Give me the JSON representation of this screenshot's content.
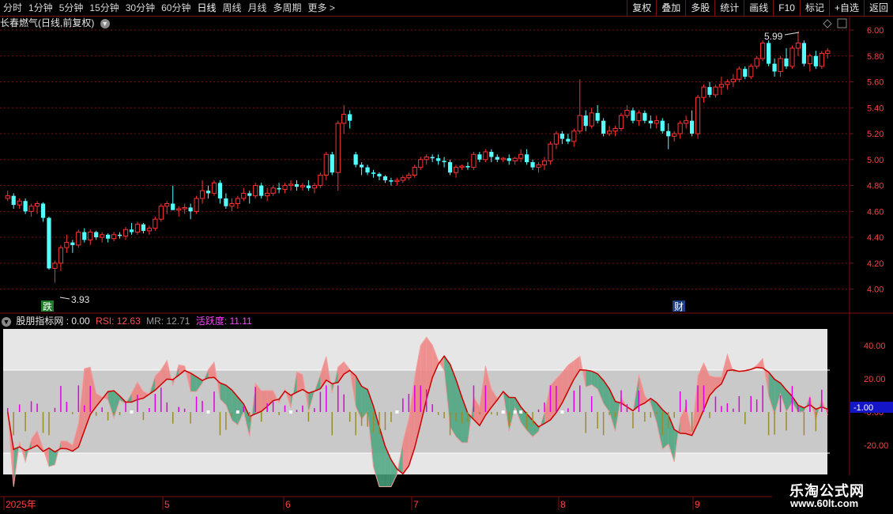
{
  "toolbar": {
    "periods": [
      "分时",
      "1分钟",
      "5分钟",
      "15分钟",
      "30分钟",
      "60分钟",
      "日线",
      "周线",
      "月线",
      "多周期",
      "更多 >"
    ],
    "active_period": "日线",
    "actions": [
      "复权",
      "叠加",
      "多股",
      "统计",
      "画线",
      "F10",
      "标记",
      "+自选",
      "返回"
    ]
  },
  "title": {
    "stock_name": "长春燃气(日线,前复权)",
    "chevron_icon": "chevron-down-icon"
  },
  "main_chart": {
    "y_ticks": [
      "6.00",
      "5.80",
      "5.60",
      "5.40",
      "5.20",
      "5.00",
      "4.80",
      "4.60",
      "4.40",
      "4.20",
      "4.00"
    ],
    "max_label": "5.99",
    "min_label": "3.93",
    "badge_down": "跌",
    "badge_finance": "财"
  },
  "indicator": {
    "name": "股朋指标网",
    "value_text": ": 0.00",
    "rsi_label": "RSI: 12.63",
    "mr_label": "MR: 12.71",
    "activity_label": "活跃度: 11.11",
    "y_ticks": [
      "40.00",
      "20.00",
      "-0.00",
      "-20.00"
    ],
    "current_value": "-1.00"
  },
  "x_axis": {
    "labels": [
      "2025年",
      "5",
      "6",
      "7",
      "8",
      "9"
    ]
  },
  "watermark": {
    "line1": "乐淘公式网",
    "line2": "www.60lt.com"
  },
  "colors": {
    "up": "#ff3232",
    "down": "#54ffff",
    "grid": "#7a1010",
    "rsi_fill_up": "#f08080",
    "rsi_fill_down": "#4aa57f",
    "activity_bar": "#e000e0",
    "neg_bar": "#9a8c2a",
    "mr_line": "#cc0000"
  },
  "chart_data": {
    "type": "candlestick",
    "ylim": [
      3.9,
      6.05
    ],
    "candles": [
      [
        4.7,
        4.76,
        4.68,
        4.72
      ],
      [
        4.72,
        4.74,
        4.62,
        4.65
      ],
      [
        4.65,
        4.7,
        4.62,
        4.68
      ],
      [
        4.68,
        4.7,
        4.58,
        4.6
      ],
      [
        4.6,
        4.66,
        4.56,
        4.64
      ],
      [
        4.64,
        4.68,
        4.58,
        4.66
      ],
      [
        4.66,
        4.67,
        4.52,
        4.55
      ],
      [
        4.55,
        4.56,
        4.15,
        4.16
      ],
      [
        4.16,
        4.22,
        4.05,
        4.2
      ],
      [
        4.2,
        4.34,
        4.14,
        4.32
      ],
      [
        4.32,
        4.42,
        4.28,
        4.36
      ],
      [
        4.36,
        4.38,
        4.28,
        4.34
      ],
      [
        4.34,
        4.46,
        4.32,
        4.44
      ],
      [
        4.44,
        4.47,
        4.36,
        4.38
      ],
      [
        4.38,
        4.46,
        4.34,
        4.44
      ],
      [
        4.44,
        4.45,
        4.38,
        4.4
      ],
      [
        4.4,
        4.44,
        4.36,
        4.42
      ],
      [
        4.42,
        4.43,
        4.36,
        4.39
      ],
      [
        4.39,
        4.44,
        4.37,
        4.42
      ],
      [
        4.42,
        4.44,
        4.39,
        4.41
      ],
      [
        4.41,
        4.48,
        4.38,
        4.46
      ],
      [
        4.46,
        4.51,
        4.42,
        4.44
      ],
      [
        4.44,
        4.52,
        4.42,
        4.5
      ],
      [
        4.5,
        4.51,
        4.43,
        4.45
      ],
      [
        4.45,
        4.49,
        4.42,
        4.47
      ],
      [
        4.47,
        4.56,
        4.45,
        4.54
      ],
      [
        4.54,
        4.66,
        4.52,
        4.64
      ],
      [
        4.64,
        4.68,
        4.58,
        4.66
      ],
      [
        4.66,
        4.8,
        4.62,
        4.61
      ],
      [
        4.61,
        4.64,
        4.56,
        4.62
      ],
      [
        4.62,
        4.66,
        4.58,
        4.63
      ],
      [
        4.63,
        4.66,
        4.54,
        4.6
      ],
      [
        4.6,
        4.72,
        4.58,
        4.7
      ],
      [
        4.7,
        4.84,
        4.66,
        4.76
      ],
      [
        4.76,
        4.8,
        4.7,
        4.74
      ],
      [
        4.74,
        4.84,
        4.72,
        4.82
      ],
      [
        4.82,
        4.84,
        4.66,
        4.7
      ],
      [
        4.7,
        4.74,
        4.62,
        4.64
      ],
      [
        4.64,
        4.7,
        4.6,
        4.66
      ],
      [
        4.66,
        4.72,
        4.62,
        4.7
      ],
      [
        4.7,
        4.78,
        4.68,
        4.74
      ],
      [
        4.74,
        4.76,
        4.66,
        4.72
      ],
      [
        4.72,
        4.82,
        4.7,
        4.8
      ],
      [
        4.8,
        4.82,
        4.7,
        4.72
      ],
      [
        4.72,
        4.78,
        4.68,
        4.74
      ],
      [
        4.74,
        4.8,
        4.72,
        4.78
      ],
      [
        4.78,
        4.82,
        4.74,
        4.77
      ],
      [
        4.77,
        4.82,
        4.74,
        4.8
      ],
      [
        4.8,
        4.84,
        4.76,
        4.81
      ],
      [
        4.81,
        4.84,
        4.76,
        4.79
      ],
      [
        4.79,
        4.82,
        4.76,
        4.8
      ],
      [
        4.8,
        4.84,
        4.76,
        4.78
      ],
      [
        4.78,
        4.82,
        4.74,
        4.8
      ],
      [
        4.8,
        4.9,
        4.78,
        4.88
      ],
      [
        4.88,
        5.06,
        4.84,
        5.04
      ],
      [
        5.04,
        5.06,
        4.88,
        4.9
      ],
      [
        4.9,
        5.3,
        4.76,
        5.28
      ],
      [
        5.28,
        5.42,
        5.2,
        5.35
      ],
      [
        5.35,
        5.38,
        5.24,
        5.3
      ],
      [
        5.04,
        5.06,
        4.94,
        4.96
      ],
      [
        4.96,
        4.98,
        4.88,
        4.94
      ],
      [
        4.94,
        4.96,
        4.88,
        4.9
      ],
      [
        4.9,
        4.92,
        4.86,
        4.89
      ],
      [
        4.89,
        4.9,
        4.84,
        4.87
      ],
      [
        4.87,
        4.88,
        4.82,
        4.84
      ],
      [
        4.84,
        4.86,
        4.8,
        4.83
      ],
      [
        4.83,
        4.86,
        4.8,
        4.84
      ],
      [
        4.84,
        4.88,
        4.82,
        4.86
      ],
      [
        4.86,
        4.9,
        4.84,
        4.88
      ],
      [
        4.88,
        4.96,
        4.86,
        4.94
      ],
      [
        4.94,
        5.02,
        4.92,
        5.0
      ],
      [
        5.0,
        5.04,
        4.96,
        5.02
      ],
      [
        5.02,
        5.04,
        4.98,
        5.01
      ],
      [
        5.01,
        5.04,
        4.96,
        4.99
      ],
      [
        4.99,
        5.02,
        4.94,
        4.98
      ],
      [
        4.98,
        5.0,
        4.88,
        4.9
      ],
      [
        4.9,
        4.96,
        4.86,
        4.94
      ],
      [
        4.94,
        4.96,
        4.92,
        4.95
      ],
      [
        4.95,
        4.98,
        4.92,
        4.94
      ],
      [
        4.94,
        5.06,
        4.92,
        5.04
      ],
      [
        5.04,
        5.06,
        4.98,
        5.0
      ],
      [
        5.0,
        5.08,
        4.98,
        5.06
      ],
      [
        5.06,
        5.08,
        4.98,
        5.02
      ],
      [
        5.02,
        5.04,
        4.98,
        5.0
      ],
      [
        5.0,
        5.02,
        4.98,
        5.01
      ],
      [
        5.01,
        5.04,
        4.96,
        4.99
      ],
      [
        4.99,
        5.02,
        4.96,
        5.01
      ],
      [
        5.01,
        5.08,
        4.98,
        5.04
      ],
      [
        5.04,
        5.08,
        4.96,
        4.98
      ],
      [
        4.98,
        5.0,
        4.92,
        4.94
      ],
      [
        4.94,
        4.98,
        4.9,
        4.96
      ],
      [
        4.96,
        5.02,
        4.92,
        4.99
      ],
      [
        4.99,
        5.14,
        4.96,
        5.12
      ],
      [
        5.12,
        5.22,
        5.08,
        5.2
      ],
      [
        5.2,
        5.22,
        5.12,
        5.16
      ],
      [
        5.16,
        5.2,
        5.12,
        5.14
      ],
      [
        5.14,
        5.24,
        5.1,
        5.22
      ],
      [
        5.22,
        5.62,
        5.2,
        5.34
      ],
      [
        5.34,
        5.38,
        5.22,
        5.26
      ],
      [
        5.26,
        5.4,
        5.24,
        5.36
      ],
      [
        5.36,
        5.42,
        5.28,
        5.3
      ],
      [
        5.3,
        5.32,
        5.18,
        5.2
      ],
      [
        5.2,
        5.26,
        5.18,
        5.22
      ],
      [
        5.22,
        5.26,
        5.18,
        5.24
      ],
      [
        5.24,
        5.36,
        5.22,
        5.34
      ],
      [
        5.34,
        5.42,
        5.32,
        5.38
      ],
      [
        5.38,
        5.4,
        5.28,
        5.3
      ],
      [
        5.3,
        5.38,
        5.26,
        5.36
      ],
      [
        5.36,
        5.38,
        5.28,
        5.3
      ],
      [
        5.3,
        5.34,
        5.24,
        5.28
      ],
      [
        5.28,
        5.34,
        5.24,
        5.3
      ],
      [
        5.3,
        5.32,
        5.2,
        5.22
      ],
      [
        5.22,
        5.28,
        5.08,
        5.18
      ],
      [
        5.18,
        5.22,
        5.14,
        5.2
      ],
      [
        5.2,
        5.3,
        5.16,
        5.28
      ],
      [
        5.28,
        5.34,
        5.24,
        5.3
      ],
      [
        5.3,
        5.38,
        5.18,
        5.2
      ],
      [
        5.2,
        5.5,
        5.16,
        5.48
      ],
      [
        5.48,
        5.58,
        5.44,
        5.56
      ],
      [
        5.56,
        5.6,
        5.48,
        5.5
      ],
      [
        5.5,
        5.58,
        5.48,
        5.56
      ],
      [
        5.56,
        5.64,
        5.5,
        5.58
      ],
      [
        5.58,
        5.62,
        5.54,
        5.6
      ],
      [
        5.6,
        5.66,
        5.56,
        5.62
      ],
      [
        5.62,
        5.72,
        5.6,
        5.7
      ],
      [
        5.7,
        5.72,
        5.62,
        5.64
      ],
      [
        5.64,
        5.74,
        5.62,
        5.72
      ],
      [
        5.72,
        5.8,
        5.7,
        5.78
      ],
      [
        5.78,
        5.92,
        5.76,
        5.9
      ],
      [
        5.9,
        5.92,
        5.72,
        5.74
      ],
      [
        5.74,
        5.78,
        5.64,
        5.68
      ],
      [
        5.68,
        5.8,
        5.64,
        5.78
      ],
      [
        5.78,
        5.86,
        5.7,
        5.72
      ],
      [
        5.72,
        5.88,
        5.7,
        5.86
      ],
      [
        5.86,
        5.99,
        5.8,
        5.9
      ],
      [
        5.9,
        5.92,
        5.72,
        5.74
      ],
      [
        5.74,
        5.82,
        5.68,
        5.8
      ],
      [
        5.8,
        5.84,
        5.7,
        5.72
      ],
      [
        5.72,
        5.84,
        5.7,
        5.82
      ],
      [
        5.82,
        5.86,
        5.78,
        5.84
      ]
    ]
  }
}
